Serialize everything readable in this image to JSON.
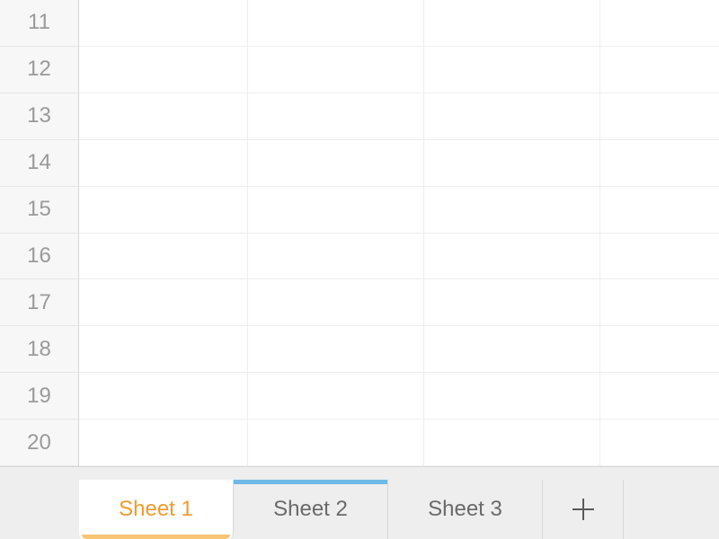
{
  "grid": {
    "visible_rows": [
      11,
      12,
      13,
      14,
      15,
      16,
      17,
      18,
      19,
      20
    ],
    "visible_columns": 4
  },
  "tabs": [
    {
      "label": "Sheet 1",
      "active": true,
      "highlighted": false
    },
    {
      "label": "Sheet 2",
      "active": false,
      "highlighted": true
    },
    {
      "label": "Sheet 3",
      "active": false,
      "highlighted": false
    }
  ]
}
